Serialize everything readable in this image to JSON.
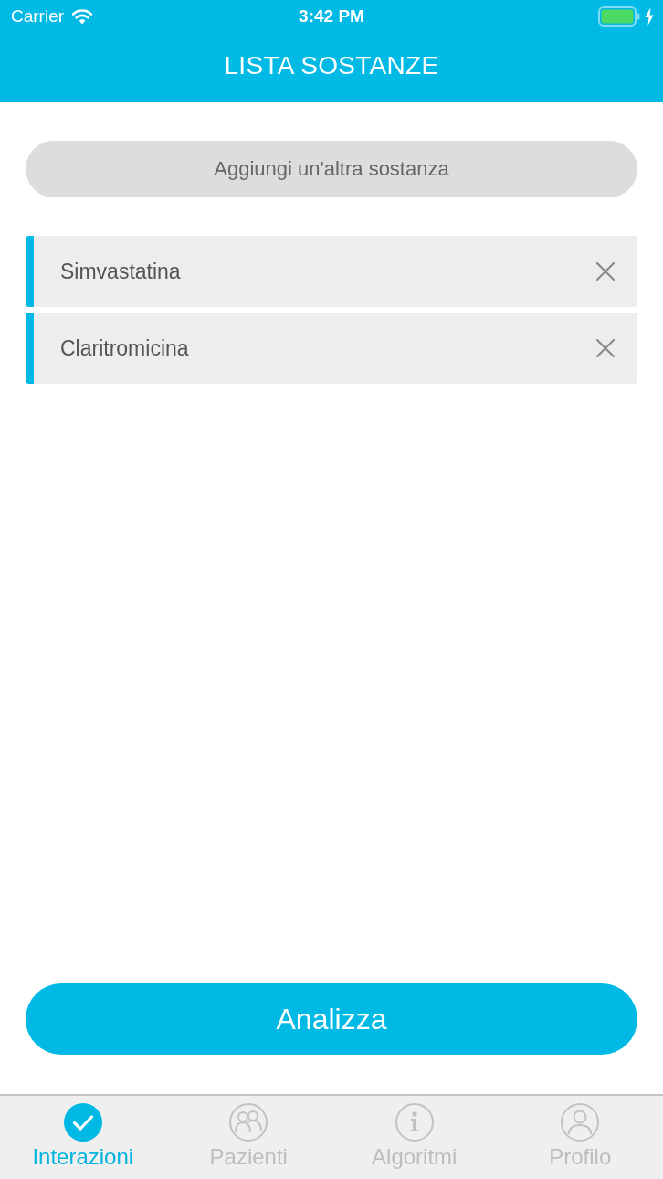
{
  "status_bar": {
    "carrier": "Carrier",
    "time": "3:42 PM"
  },
  "nav_bar": {
    "title": "LISTA SOSTANZE"
  },
  "add_button": {
    "label": "Aggiungi un'altra sostanza"
  },
  "substances": [
    {
      "name": "Simvastatina"
    },
    {
      "name": "Claritromicina"
    }
  ],
  "analyze_button": {
    "label": "Analizza"
  },
  "tab_bar": {
    "tabs": [
      {
        "label": "Interazioni",
        "kind": "check",
        "selected": true
      },
      {
        "label": "Pazienti",
        "kind": "people",
        "selected": false
      },
      {
        "label": "Algoritmi",
        "kind": "info",
        "selected": false
      },
      {
        "label": "Profilo",
        "kind": "person",
        "selected": false
      }
    ]
  }
}
